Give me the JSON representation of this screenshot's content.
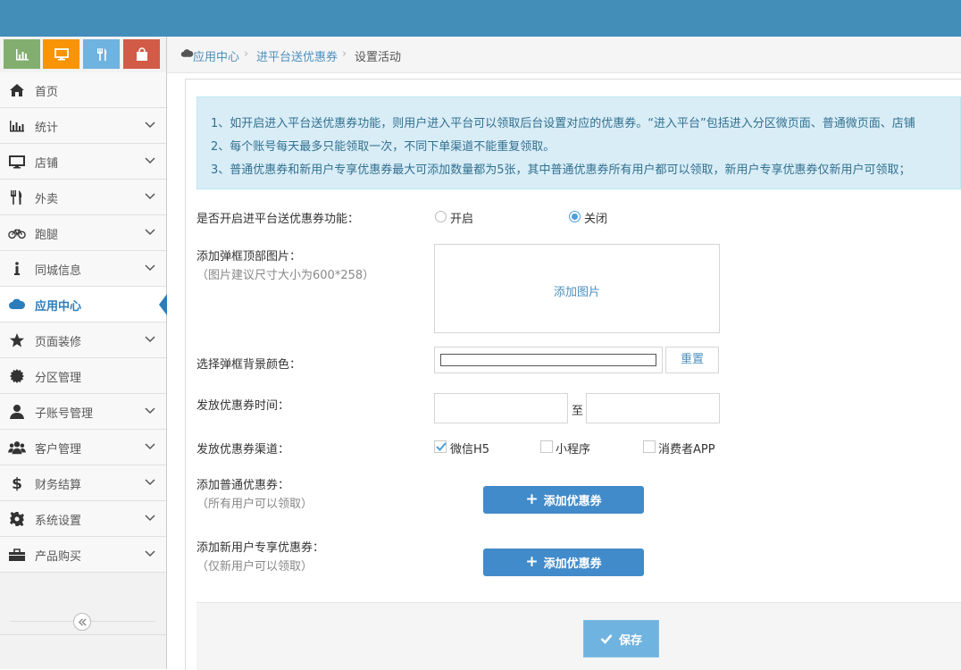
{
  "colors": {
    "topbar": "#438eb9",
    "accent": "#2b7dbc",
    "shortcut_1": "#82af6f",
    "shortcut_2": "#f89406",
    "shortcut_3": "#6fb3e0",
    "shortcut_4": "#d15b47"
  },
  "shortcuts": [
    {
      "icon": "bar-chart-icon"
    },
    {
      "icon": "desktop-icon"
    },
    {
      "icon": "utensils-icon"
    },
    {
      "icon": "shopping-bag-icon"
    }
  ],
  "sidebar": {
    "items": [
      {
        "label": "首页",
        "icon": "home-icon"
      },
      {
        "label": "统计",
        "icon": "bar-chart-icon"
      },
      {
        "label": "店铺",
        "icon": "desktop-icon"
      },
      {
        "label": "外卖",
        "icon": "cutlery-icon"
      },
      {
        "label": "跑腿",
        "icon": "bicycle-icon"
      },
      {
        "label": "同城信息",
        "icon": "info-icon"
      },
      {
        "label": "应用中心",
        "icon": "cloud-icon"
      },
      {
        "label": "页面装修",
        "icon": "star-icon"
      },
      {
        "label": "分区管理",
        "icon": "gear-badge-icon"
      },
      {
        "label": "子账号管理",
        "icon": "user-icon"
      },
      {
        "label": "客户管理",
        "icon": "users-icon"
      },
      {
        "label": "财务结算",
        "icon": "dollar-icon"
      },
      {
        "label": "系统设置",
        "icon": "cog-icon"
      },
      {
        "label": "产品购买",
        "icon": "briefcase-icon"
      }
    ]
  },
  "breadcrumb": {
    "home": "应用中心",
    "parent": "进平台送优惠券",
    "current": "设置活动"
  },
  "notice": {
    "line1": "1、如开启进入平台送优惠券功能，则用户进入平台可以领取后台设置对应的优惠券。“进入平台”包括进入分区微页面、普通微页面、店铺",
    "line2": "2、每个账号每天最多只能领取一次，不同下单渠道不能重复领取。",
    "line3": "3、普通优惠券和新用户专享优惠券最大可添加数量都为5张，其中普通优惠券所有用户都可以领取，新用户专享优惠券仅新用户可领取；"
  },
  "form": {
    "enable_label": "是否开启进平台送优惠券功能：",
    "enable_on": "开启",
    "enable_off": "关闭",
    "image_label": "添加弹框顶部图片：",
    "image_hint": "（图片建议尺寸大小为600*258）",
    "image_add": "添加图片",
    "color_label": "选择弹框背景颜色：",
    "color_reset": "重置",
    "time_label": "发放优惠券时间：",
    "time_sep": "至",
    "channel_label": "发放优惠券渠道：",
    "channel_wechat": "微信H5",
    "channel_mini": "小程序",
    "channel_app": "消费者APP",
    "normal_label": "添加普通优惠券：",
    "normal_hint": "（所有用户可以领取）",
    "normal_btn": "添加优惠券",
    "new_label": "添加新用户专享优惠券：",
    "new_hint": "（仅新用户可以领取）",
    "new_btn": "添加优惠券",
    "save": "保存"
  }
}
